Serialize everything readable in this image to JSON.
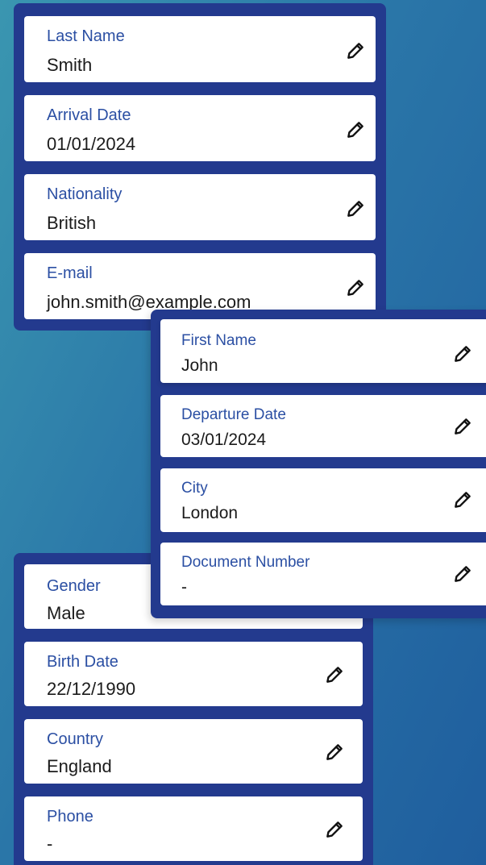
{
  "panel_a": {
    "fields": [
      {
        "label": "Last Name",
        "value": "Smith"
      },
      {
        "label": "Arrival Date",
        "value": "01/01/2024"
      },
      {
        "label": "Nationality",
        "value": "British"
      },
      {
        "label": "E-mail",
        "value": "john.smith@example.com"
      }
    ]
  },
  "panel_b": {
    "fields": [
      {
        "label": "First Name",
        "value": "John"
      },
      {
        "label": "Departure Date",
        "value": "03/01/2024"
      },
      {
        "label": "City",
        "value": "London"
      },
      {
        "label": "Document Number",
        "value": "-"
      }
    ]
  },
  "panel_c": {
    "fields": [
      {
        "label": "Gender",
        "value": "Male"
      },
      {
        "label": "Birth Date",
        "value": "22/12/1990"
      },
      {
        "label": "Country",
        "value": "England"
      },
      {
        "label": "Phone",
        "value": "-"
      }
    ]
  },
  "icons": {
    "edit": "pencil-icon"
  }
}
